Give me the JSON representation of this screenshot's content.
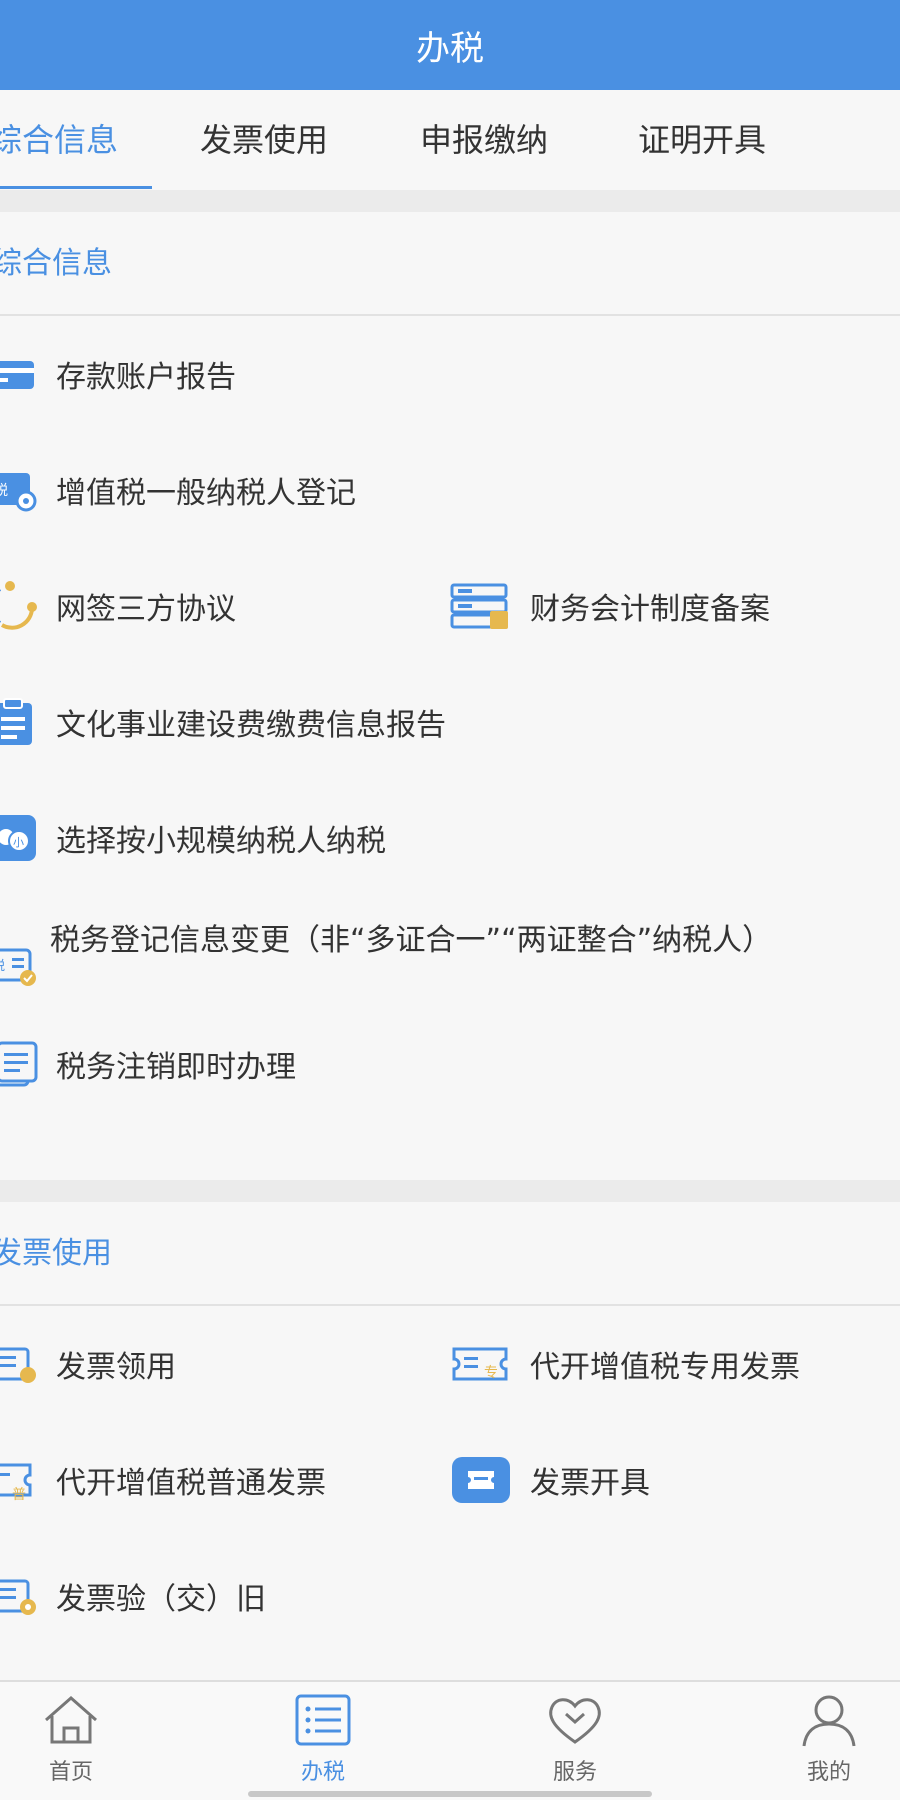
{
  "header": {
    "title": "办税"
  },
  "tabs": [
    {
      "label": "综合信息",
      "active": true
    },
    {
      "label": "发票使用",
      "active": false
    },
    {
      "label": "申报缴纳",
      "active": false
    },
    {
      "label": "证明开具",
      "active": false
    }
  ],
  "sections": [
    {
      "title": "综合信息",
      "items": [
        {
          "label": "存款账户报告",
          "icon": "bank-card-icon"
        },
        {
          "label": "增值税一般纳税人登记",
          "icon": "tax-register-icon"
        },
        {
          "label": "网签三方协议",
          "icon": "three-party-agreement-icon"
        },
        {
          "label": "财务会计制度备案",
          "icon": "accounting-filing-icon"
        },
        {
          "label": "文化事业建设费缴费信息报告",
          "icon": "clipboard-icon"
        },
        {
          "label": "选择按小规模纳税人纳税",
          "icon": "small-scale-taxpayer-icon"
        },
        {
          "label": "税务登记信息变更（非“多证合一”“两证整合”纳税人）",
          "icon": "registration-change-icon"
        },
        {
          "label": "税务注销即时办理",
          "icon": "deregistration-icon"
        }
      ]
    },
    {
      "title": "发票使用",
      "items": [
        {
          "label": "发票领用",
          "icon": "invoice-receive-icon"
        },
        {
          "label": "代开增值税专用发票",
          "icon": "special-invoice-icon"
        },
        {
          "label": "代开增值税普通发票",
          "icon": "ordinary-invoice-icon"
        },
        {
          "label": "发票开具",
          "icon": "invoice-issue-icon"
        },
        {
          "label": "发票验（交）旧",
          "icon": "invoice-verify-icon"
        }
      ]
    }
  ],
  "bottom_nav": [
    {
      "label": "首页",
      "icon": "home-icon",
      "active": false
    },
    {
      "label": "办税",
      "icon": "list-icon",
      "active": true
    },
    {
      "label": "服务",
      "icon": "heart-icon",
      "active": false
    },
    {
      "label": "我的",
      "icon": "user-icon",
      "active": false
    }
  ],
  "colors": {
    "accent": "#4a90e2",
    "icon_gold": "#e6b84e",
    "background": "#f6f6f6"
  }
}
